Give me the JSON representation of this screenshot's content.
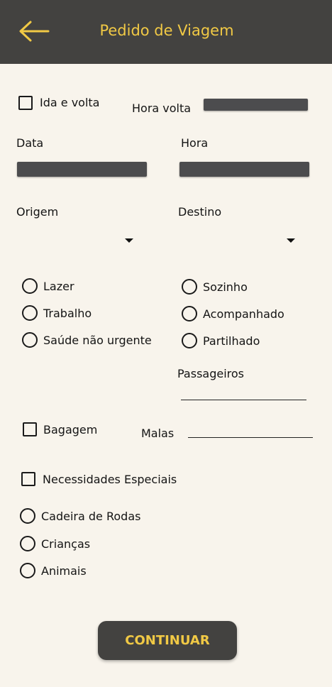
{
  "header": {
    "title": "Pedido de Viagem",
    "back_icon": "arrow-left-icon"
  },
  "trip": {
    "round_trip_label": "Ida e volta",
    "return_time_label": "Hora volta",
    "date_label": "Data",
    "time_label": "Hora",
    "origin_label": "Origem",
    "destination_label": "Destino"
  },
  "purpose": {
    "options": [
      "Lazer",
      "Trabalho",
      "Saúde não urgente"
    ]
  },
  "company": {
    "options": [
      "Sozinho",
      "Acompanhado",
      "Partilhado"
    ]
  },
  "passengers_label": "Passageiros",
  "luggage": {
    "label": "Bagagem",
    "bags_label": "Malas"
  },
  "special_needs": {
    "label": "Necessidades Especiais",
    "options": [
      "Cadeira de Rodas",
      "Crianças",
      "Animais"
    ]
  },
  "continue_label": "CONTINUAR",
  "colors": {
    "header_bg": "#434240",
    "accent": "#f1c945",
    "page_bg": "#f8f4ec"
  }
}
